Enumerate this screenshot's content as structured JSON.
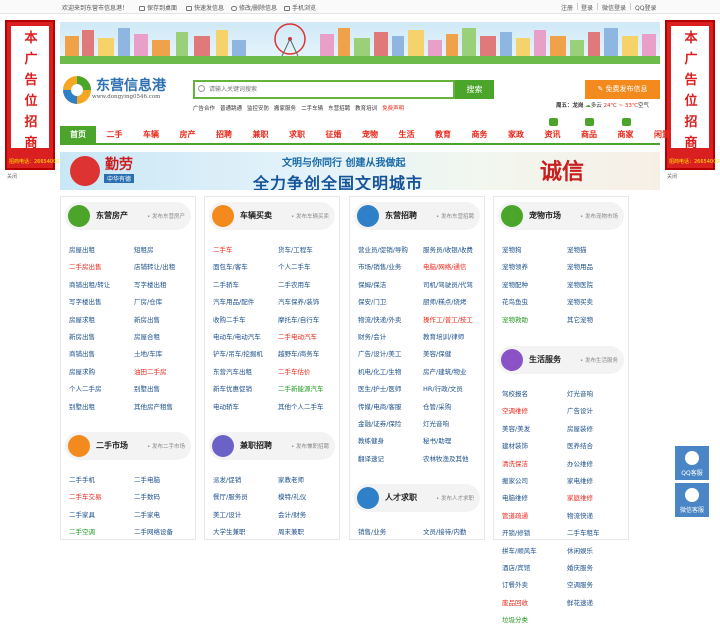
{
  "topbar": {
    "welcome": "欢迎来到东营市信息港！",
    "save_desktop": "保存到桌面",
    "quick_post": "快速发信息",
    "edit_delete": "修改/删除信息",
    "mobile": "手机浏览",
    "register": "注册",
    "login": "登录",
    "wechat_login": "微信登录",
    "qq_login": "QQ登录"
  },
  "sidead": {
    "text": [
      "本",
      "广",
      "告",
      "位",
      "招",
      "商"
    ],
    "phone": "招商电话：2665400026",
    "close": "关闭"
  },
  "logo": {
    "name": "东营信息港",
    "url": "www.dongying0546.com"
  },
  "search": {
    "placeholder": "请输入关键词搜索",
    "button": "搜索"
  },
  "publish": {
    "label": "免费发布信息"
  },
  "hotlinks": [
    "广告合作",
    "普通跳通",
    "监控安防",
    "搬家服务",
    "二手车辆",
    "东营招聘",
    "教育培训",
    "免费声明"
  ],
  "weather": {
    "day": "周五：",
    "city": "龙岗",
    "cond": "多云",
    "temp": "24℃ ~ 33℃",
    "air": "空气"
  },
  "nav": [
    "首页",
    "二手",
    "车辆",
    "房产",
    "招聘",
    "兼职",
    "求职",
    "征婚",
    "宠物",
    "生活",
    "教育",
    "商务",
    "家政",
    "资讯",
    "商品",
    "商家",
    "闲置"
  ],
  "ad2": {
    "line1": "文明与你同行 创建从我做起",
    "line2": "全力争创全国文明城市",
    "brand": "诚信",
    "left": "勤劳",
    "sub": "中华有德"
  },
  "sections": {
    "house": {
      "title": "东营房产",
      "pub": "发布东营房产",
      "links": [
        [
          "房屋出租",
          "red0"
        ],
        [
          "短租房",
          ""
        ],
        [
          "二手房出售",
          "red"
        ],
        [
          "店铺转让/出租",
          ""
        ],
        [
          "商铺出租/转让",
          ""
        ],
        [
          "写字楼出租",
          ""
        ],
        [
          "写字楼出售",
          ""
        ],
        [
          "厂房/仓库",
          ""
        ],
        [
          "房屋求租",
          ""
        ],
        [
          "新房出售",
          ""
        ],
        [
          "新房出售",
          ""
        ],
        [
          "房屋合租",
          ""
        ],
        [
          "商铺出售",
          ""
        ],
        [
          "土地/车库",
          ""
        ],
        [
          "房屋求购",
          ""
        ],
        [
          "油田二手房",
          "red"
        ],
        [
          "个人二手房",
          ""
        ],
        [
          "别墅出售",
          ""
        ],
        [
          "别墅出租",
          ""
        ],
        [
          "其他房产租售",
          ""
        ]
      ]
    },
    "market": {
      "title": "二手市场",
      "pub": "发布二手市场",
      "links": [
        [
          "二手手机",
          ""
        ],
        [
          "二手电脑",
          ""
        ],
        [
          "二手车交易",
          "red"
        ],
        [
          "二手数码",
          ""
        ],
        [
          "二手家具",
          ""
        ],
        [
          "二手家电",
          ""
        ],
        [
          "二手空调",
          "green"
        ],
        [
          "二手网络设备",
          ""
        ]
      ]
    },
    "car": {
      "title": "车辆买卖",
      "pub": "发布车辆买卖",
      "links": [
        [
          "二手车",
          "red"
        ],
        [
          "货车/工程车",
          ""
        ],
        [
          "面包车/客车",
          ""
        ],
        [
          "个人二手车",
          ""
        ],
        [
          "二手轿车",
          ""
        ],
        [
          "二手农用车",
          ""
        ],
        [
          "汽车用品/配件",
          ""
        ],
        [
          "汽车保养/装饰",
          ""
        ],
        [
          "收购二手车",
          ""
        ],
        [
          "摩托车/自行车",
          ""
        ],
        [
          "电动车/电动汽车",
          ""
        ],
        [
          "二手电动汽车",
          "red"
        ],
        [
          "铲车/吊车/挖掘机",
          ""
        ],
        [
          "越野车/商务车",
          ""
        ],
        [
          "东营汽车出租",
          ""
        ],
        [
          "二手车估价",
          "red"
        ],
        [
          "新车优惠促销",
          ""
        ],
        [
          "二手新能源汽车",
          "green"
        ],
        [
          "电动轿车",
          ""
        ],
        [
          "其他个人二手车",
          ""
        ]
      ]
    },
    "parttime": {
      "title": "兼职招聘",
      "pub": "发布兼职招聘",
      "links": [
        [
          "派发/促销",
          ""
        ],
        [
          "家教老师",
          ""
        ],
        [
          "餐厅/服务员",
          ""
        ],
        [
          "模特/礼仪",
          ""
        ],
        [
          "美工/设计",
          ""
        ],
        [
          "会计/财务",
          ""
        ],
        [
          "大学生兼职",
          ""
        ],
        [
          "周末兼职",
          ""
        ]
      ]
    },
    "job": {
      "title": "东营招聘",
      "pub": "发布东营招聘",
      "links": [
        [
          "营业员/促销/导购",
          ""
        ],
        [
          "服务员/收银/收费",
          ""
        ],
        [
          "市场/销售/业务",
          ""
        ],
        [
          "电脑/网络/通信",
          "red"
        ],
        [
          "保姆/保洁",
          ""
        ],
        [
          "司机/驾驶员/代驾",
          ""
        ],
        [
          "保安/门卫",
          ""
        ],
        [
          "厨师/糕点/烧烤",
          ""
        ],
        [
          "物流/快递/外卖",
          ""
        ],
        [
          "操作工/普工/技工",
          "red"
        ],
        [
          "财务/会计",
          ""
        ],
        [
          "教育培训/律师",
          ""
        ],
        [
          "广告/设计/美工",
          ""
        ],
        [
          "美容/保健",
          ""
        ],
        [
          "机电/化工/生物",
          ""
        ],
        [
          "房产/建筑/物业",
          ""
        ],
        [
          "医生/护士/医师",
          ""
        ],
        [
          "HR/行政/文员",
          ""
        ],
        [
          "传媒/电商/客服",
          ""
        ],
        [
          "仓管/采购",
          ""
        ],
        [
          "金融/证券/保险",
          ""
        ],
        [
          "灯光音响",
          ""
        ],
        [
          "教练健身",
          ""
        ],
        [
          "秘书/助理",
          ""
        ],
        [
          "翻译速记",
          ""
        ],
        [
          "农林牧渔及其他",
          ""
        ]
      ]
    },
    "talent": {
      "title": "人才求职",
      "pub": "发布人才求职",
      "links": [
        [
          "销售/业务",
          ""
        ],
        [
          "文员/接待/内勤",
          ""
        ]
      ]
    },
    "pet": {
      "title": "宠物市场",
      "pub": "发布宠物市场",
      "links": [
        [
          "宠物狗",
          ""
        ],
        [
          "宠物猫",
          ""
        ],
        [
          "宠物领养",
          ""
        ],
        [
          "宠物用品",
          ""
        ],
        [
          "宠物配种",
          ""
        ],
        [
          "宠物医院",
          ""
        ],
        [
          "花鸟鱼虫",
          ""
        ],
        [
          "宠物买卖",
          ""
        ],
        [
          "宠物救助",
          "green"
        ],
        [
          "其它宠物",
          ""
        ]
      ]
    },
    "life": {
      "title": "生活服务",
      "pub": "发布生活服务",
      "links": [
        [
          "驾校报名",
          ""
        ],
        [
          "灯光音响",
          ""
        ],
        [
          "空调维修",
          "red"
        ],
        [
          "广告设计",
          ""
        ],
        [
          "美容/美发",
          ""
        ],
        [
          "房屋装修",
          ""
        ],
        [
          "建材装饰",
          ""
        ],
        [
          "医养结合",
          ""
        ],
        [
          "清洗保洁",
          "red"
        ],
        [
          "办公维修",
          ""
        ],
        [
          "搬家公司",
          ""
        ],
        [
          "家电维修",
          ""
        ],
        [
          "电脑维修",
          ""
        ],
        [
          "家庭维修",
          "red"
        ],
        [
          "管道疏通",
          "red"
        ],
        [
          "物流快递",
          ""
        ],
        [
          "开锁/修锁",
          ""
        ],
        [
          "二手车租车",
          ""
        ],
        [
          "拼车/顺风车",
          ""
        ],
        [
          "休闲娱乐",
          ""
        ],
        [
          "酒店/宾馆",
          ""
        ],
        [
          "婚庆服务",
          ""
        ],
        [
          "订餐外卖",
          ""
        ],
        [
          "空调服务",
          ""
        ],
        [
          "废品回收",
          "red"
        ],
        [
          "鲜花速递",
          ""
        ],
        [
          "垃圾分类",
          "green"
        ]
      ]
    }
  },
  "float": {
    "qq": "QQ客服",
    "wechat": "微信客服"
  }
}
